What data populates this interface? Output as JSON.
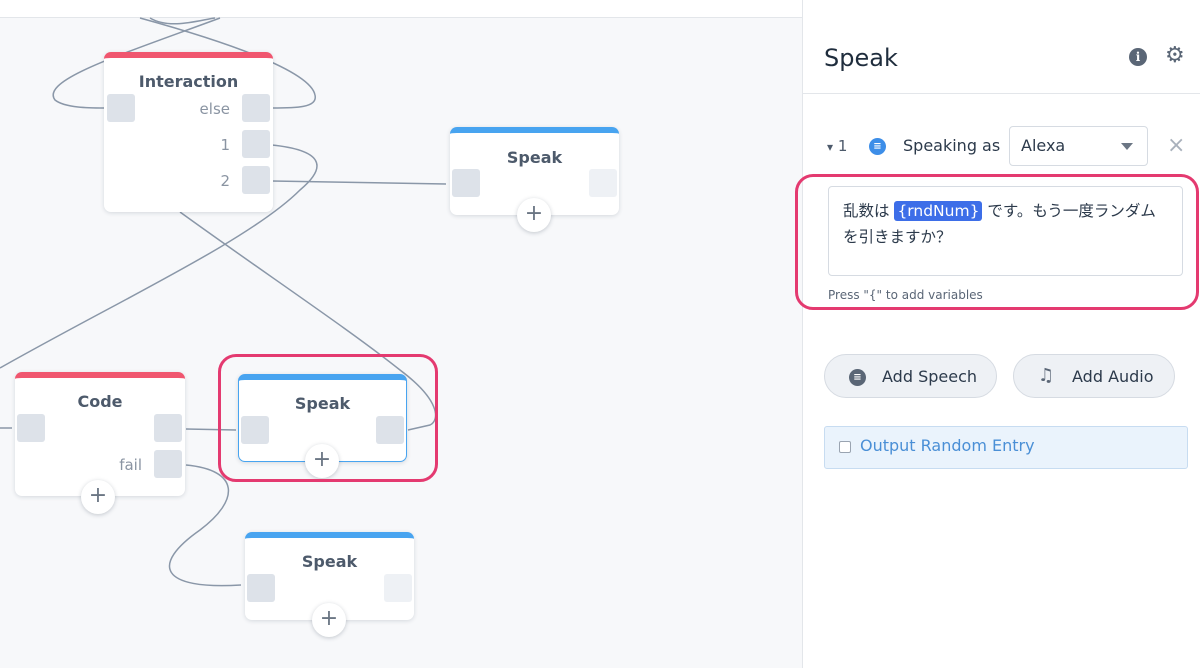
{
  "canvas": {
    "nodes": {
      "interaction": {
        "title": "Interaction",
        "ports": [
          "else",
          "1",
          "2"
        ]
      },
      "speak_top": {
        "title": "Speak"
      },
      "code": {
        "title": "Code",
        "fail_label": "fail"
      },
      "speak_selected": {
        "title": "Speak"
      },
      "speak_bottom": {
        "title": "Speak"
      }
    },
    "add_symbol": "+"
  },
  "panel": {
    "title": "Speak",
    "info_icon": "i",
    "gear_icon": "⚙",
    "entry": {
      "index_caret": "▾",
      "index": "1",
      "speaking_as_label": "Speaking as",
      "voice": "Alexa",
      "remove_icon": "×",
      "text_before": "乱数は ",
      "variable": "{rndNum}",
      "text_after": " です。もう一度ランダムを引きますか？",
      "hint": "Press \"{\" to add variables"
    },
    "add_speech_label": "Add Speech",
    "add_audio_label": "Add Audio",
    "output_random_label": "Output Random Entry",
    "colors": {
      "accent_blue": "#48a4f0",
      "accent_red": "#f0566f",
      "highlight": "#e43a70",
      "variable_chip": "#3d6ee8"
    },
    "icons": [
      "info-icon",
      "gear-icon",
      "chat-bubble-icon",
      "caret-down-icon",
      "close-icon",
      "music-note-icon",
      "checkbox-icon",
      "plus-icon"
    ]
  }
}
